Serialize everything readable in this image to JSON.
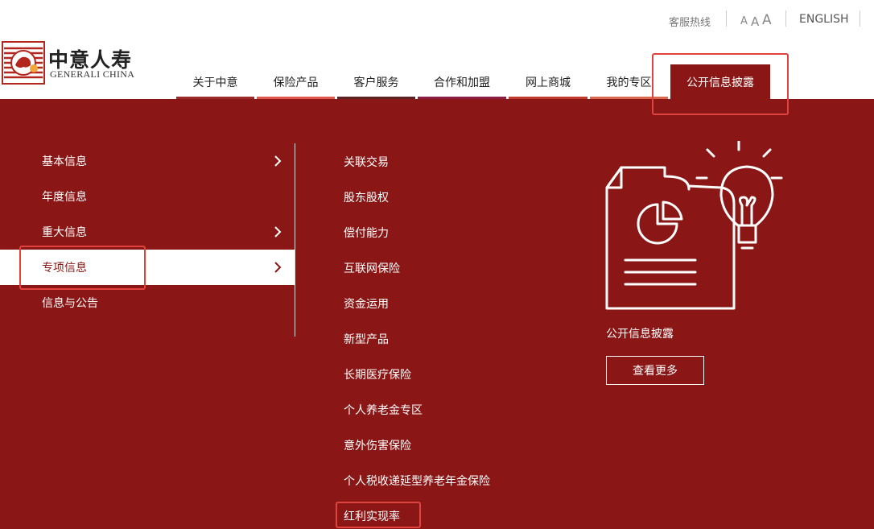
{
  "topbar": {
    "hotline": "客服热线",
    "font_sizes": [
      "A",
      "A",
      "A"
    ],
    "english": "ENGLISH"
  },
  "logo": {
    "name": "中意人寿",
    "en": "GENERALI CHINA"
  },
  "nav": [
    {
      "label": "关于中意",
      "bar_color": "#9b2b28"
    },
    {
      "label": "保险产品",
      "bar_color": "#e0564c"
    },
    {
      "label": "客户服务",
      "bar_color": "#5b2323"
    },
    {
      "label": "合作和加盟",
      "bar_color": "#8a1e43"
    },
    {
      "label": "网上商城",
      "bar_color": "#c0392b"
    },
    {
      "label": "我的专区",
      "bar_color": "#d9694f"
    },
    {
      "label": "公开信息披露",
      "active": true
    }
  ],
  "mega": {
    "left": [
      {
        "label": "基本信息",
        "has_children": true
      },
      {
        "label": "年度信息",
        "has_children": false
      },
      {
        "label": "重大信息",
        "has_children": true
      },
      {
        "label": "专项信息",
        "has_children": true,
        "active": true
      },
      {
        "label": "信息与公告",
        "has_children": false
      }
    ],
    "right": [
      "关联交易",
      "股东股权",
      "偿付能力",
      "互联网保险",
      "资金运用",
      "新型产品",
      "长期医疗保险",
      "个人养老金专区",
      "意外伤害保险",
      "个人税收递延型养老年金保险",
      "红利实现率"
    ],
    "promo_title": "公开信息披露",
    "more_button": "查看更多"
  },
  "colors": {
    "brand": "#8a1716",
    "highlight": "#e0433d"
  }
}
